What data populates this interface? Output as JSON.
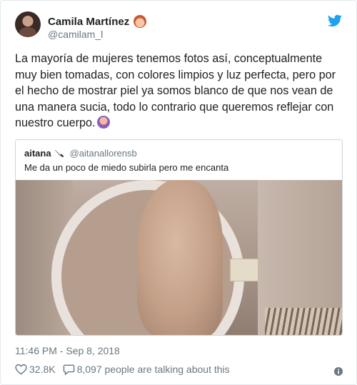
{
  "author": {
    "display_name": "Camila Martínez",
    "handle": "@camilam_l"
  },
  "tweet": {
    "text": "La mayoría de mujeres tenemos fotos así, conceptualmente muy bien tomadas, con colores limpios y luz perfecta, pero por el hecho de mostrar piel ya somos blanco de que nos vean de una manera sucia, todo lo contrario que queremos reflejar con nuestro cuerpo.",
    "timestamp": "11:46 PM - Sep 8, 2018"
  },
  "quoted": {
    "name": "aitana",
    "handle": "@aitanallorensb",
    "text": "Me da un poco de miedo subirla pero me encanta"
  },
  "footer": {
    "likes": "32.8K",
    "talking": "8,097 people are talking about this"
  },
  "icons": {
    "brand": "twitter-bird-icon",
    "like": "heart-icon",
    "reply": "speech-bubble-icon",
    "info": "info-icon"
  },
  "colors": {
    "brand": "#1da1f2",
    "muted": "#697882",
    "text": "#1c2022",
    "border": "#e1e8ed"
  }
}
